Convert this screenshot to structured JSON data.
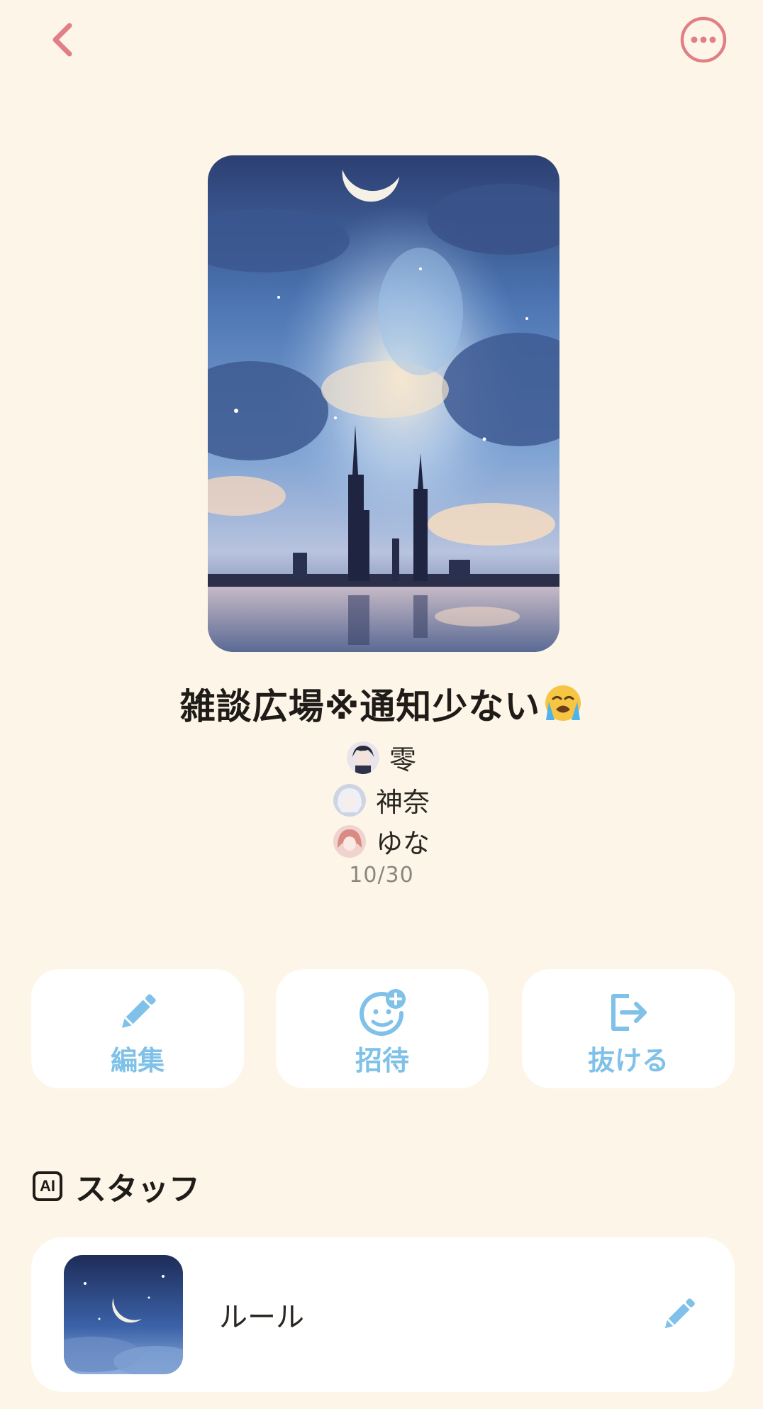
{
  "header": {
    "back_icon": "chevron-left-icon",
    "more_icon": "more-horizontal-icon"
  },
  "group": {
    "title": "雑談広場※通知少ない",
    "title_emoji": "loudly-crying-face-emoji",
    "members": [
      {
        "name": "零"
      },
      {
        "name": "神奈"
      },
      {
        "name": "ゆな"
      }
    ],
    "member_count": "10/30"
  },
  "actions": [
    {
      "label": "編集",
      "icon": "pencil-icon"
    },
    {
      "label": "招待",
      "icon": "invite-face-plus-icon"
    },
    {
      "label": "抜ける",
      "icon": "exit-icon"
    }
  ],
  "staff_section": {
    "badge": "AI",
    "title": "スタッフ",
    "items": [
      {
        "label": "ルール",
        "edit_icon": "pencil-icon"
      }
    ]
  },
  "colors": {
    "background": "#fdf6e8",
    "accent_pink": "#e27f86",
    "accent_blue": "#7fc1e8",
    "card": "#ffffff"
  }
}
